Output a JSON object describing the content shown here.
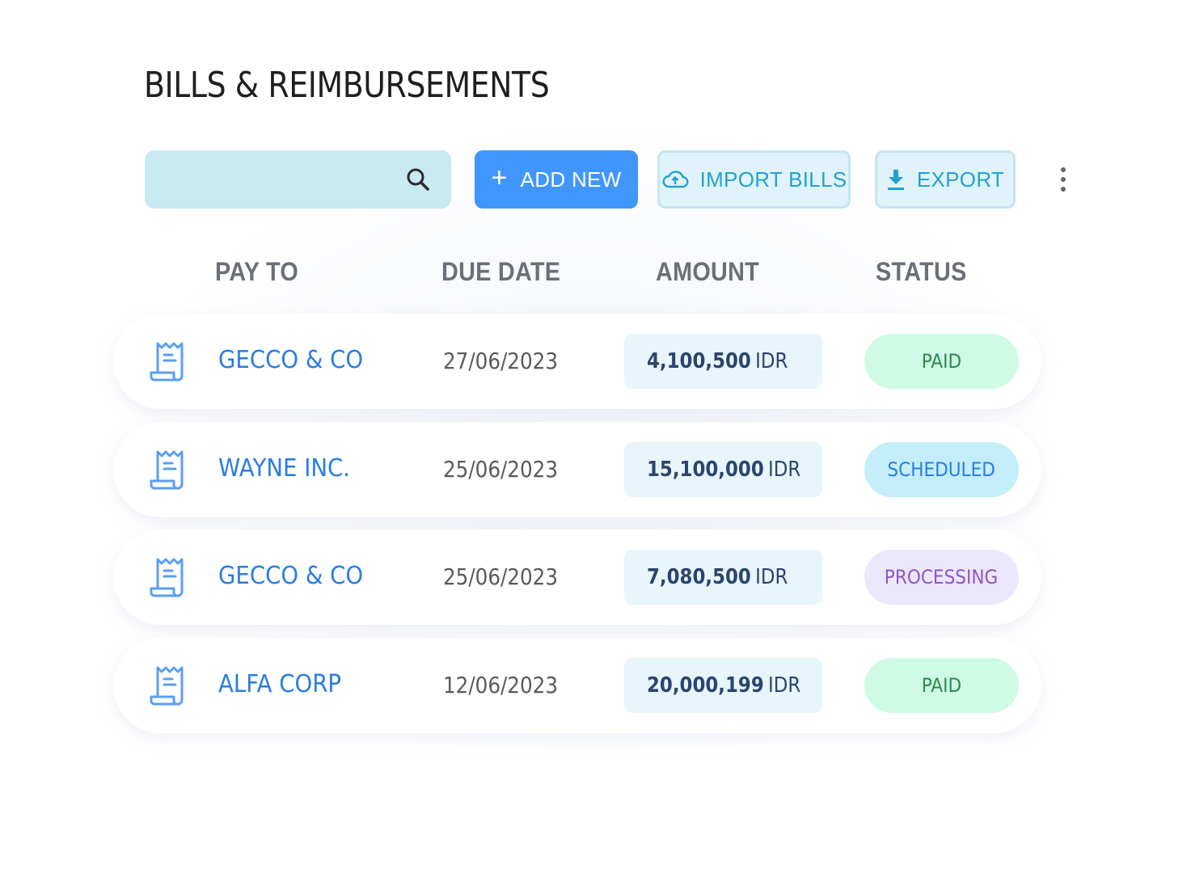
{
  "page": {
    "title": "BILLS & REIMBURSEMENTS"
  },
  "toolbar": {
    "search": {
      "value": "",
      "placeholder": "",
      "icon": "search-icon"
    },
    "add_new": {
      "label": "ADD NEW",
      "icon": "plus-icon"
    },
    "import_bills": {
      "label": "IMPORT BILLS",
      "icon": "cloud-upload-icon"
    },
    "export": {
      "label": "EXPORT",
      "icon": "download-icon"
    },
    "more": {
      "icon": "more-vertical-icon"
    }
  },
  "table": {
    "headers": [
      "PAY TO",
      "DUE DATE",
      "AMOUNT",
      "STATUS"
    ],
    "rows": [
      {
        "icon": "receipt-icon",
        "pay_to": "GECCO & CO",
        "due_date": "27/06/2023",
        "amount": "4,100,500",
        "currency": "IDR",
        "status": "PAID",
        "status_type": "paid"
      },
      {
        "icon": "receipt-icon",
        "pay_to": "WAYNE INC.",
        "due_date": "25/06/2023",
        "amount": "15,100,000",
        "currency": "IDR",
        "status": "SCHEDULED",
        "status_type": "scheduled"
      },
      {
        "icon": "receipt-icon",
        "pay_to": "GECCO & CO",
        "due_date": "25/06/2023",
        "amount": "7,080,500",
        "currency": "IDR",
        "status": "PROCESSING",
        "status_type": "processing"
      },
      {
        "icon": "receipt-icon",
        "pay_to": "ALFA CORP",
        "due_date": "12/06/2023",
        "amount": "20,000,199",
        "currency": "IDR",
        "status": "PAID",
        "status_type": "paid"
      }
    ]
  },
  "colors": {
    "accent": "#4196fb",
    "link": "#2a7de1",
    "status": {
      "paid": {
        "bg": "#cffbe6",
        "fg": "#2a8a4a"
      },
      "scheduled": {
        "bg": "#c3eefa",
        "fg": "#2a7de1"
      },
      "processing": {
        "bg": "#ebe8fd",
        "fg": "#9255c4"
      }
    }
  }
}
